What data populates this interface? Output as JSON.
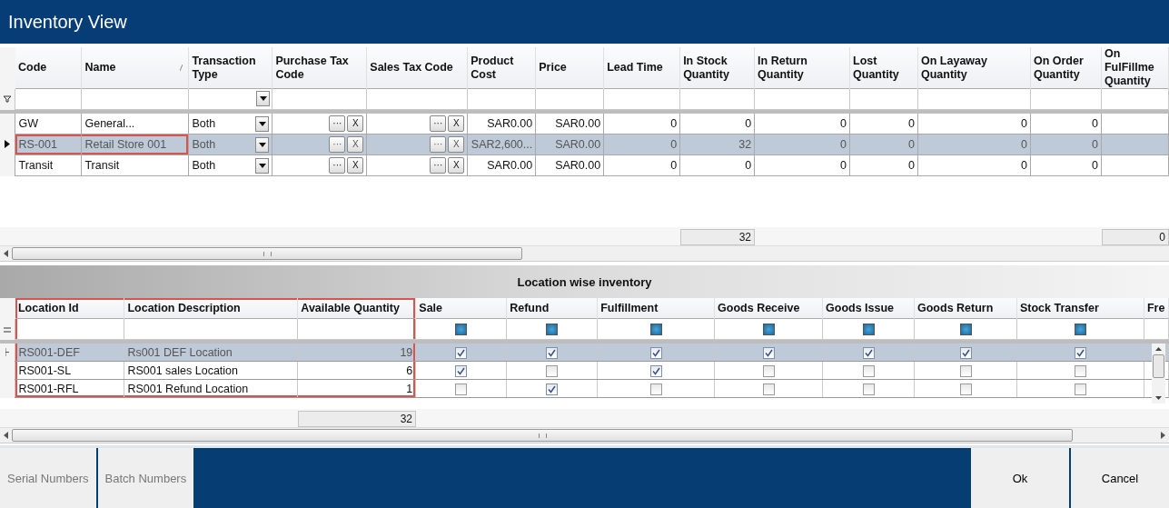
{
  "window": {
    "title": "Inventory View"
  },
  "stores_grid": {
    "columns": [
      {
        "label": "Code",
        "kind": "text",
        "sorted": false
      },
      {
        "label": "Name",
        "kind": "text",
        "sorted": true
      },
      {
        "label": "Transaction Type",
        "kind": "dropdown",
        "sorted": false
      },
      {
        "label": "Purchase Tax Code",
        "kind": "lookup",
        "sorted": false
      },
      {
        "label": "Sales Tax Code",
        "kind": "lookup",
        "sorted": false
      },
      {
        "label": "Product Cost",
        "kind": "number",
        "sorted": false
      },
      {
        "label": "Price",
        "kind": "number",
        "sorted": false
      },
      {
        "label": "Lead Time",
        "kind": "number",
        "sorted": false
      },
      {
        "label": "In Stock Quantity",
        "kind": "number",
        "sorted": false,
        "total": "32"
      },
      {
        "label": "In Return Quantity",
        "kind": "number",
        "sorted": false
      },
      {
        "label": "Lost Quantity",
        "kind": "number",
        "sorted": false
      },
      {
        "label": "On Layaway Quantity",
        "kind": "number",
        "sorted": false
      },
      {
        "label": "On Order Quantity",
        "kind": "number",
        "sorted": false
      },
      {
        "label": "On FulFillme Quantity",
        "kind": "number",
        "sorted": false,
        "total": "0"
      }
    ],
    "rows": [
      {
        "selected": false,
        "outlined": false,
        "cells": [
          "GW",
          "General...",
          "Both",
          {
            "browse": "···",
            "clear": "X"
          },
          {
            "browse": "···",
            "clear": "X"
          },
          "SAR0.00",
          "SAR0.00",
          "0",
          "0",
          "0",
          "0",
          "0",
          "0",
          ""
        ]
      },
      {
        "selected": true,
        "outlined": true,
        "cells": [
          "RS-001",
          "Retail Store 001",
          "Both",
          {
            "browse": "···",
            "clear": "X"
          },
          {
            "browse": "···",
            "clear": "X"
          },
          "SAR2,600...",
          "SAR0.00",
          "0",
          "32",
          "0",
          "0",
          "0",
          "0",
          ""
        ]
      },
      {
        "selected": false,
        "outlined": false,
        "cells": [
          "Transit",
          "Transit",
          "Both",
          {
            "browse": "···",
            "clear": "X"
          },
          {
            "browse": "···",
            "clear": "X"
          },
          "SAR0.00",
          "SAR0.00",
          "0",
          "0",
          "0",
          "0",
          "0",
          "0",
          ""
        ]
      }
    ]
  },
  "locations_grid": {
    "title": "Location wise inventory",
    "columns": [
      {
        "label": "Location Id",
        "kind": "text",
        "outlined": true
      },
      {
        "label": "Location Description",
        "kind": "text",
        "outlined": true
      },
      {
        "label": "Available Quantity",
        "kind": "number",
        "outlined": true,
        "total": "32"
      },
      {
        "label": "Sale",
        "kind": "check",
        "outlined": false,
        "filter_mixed": true
      },
      {
        "label": "Refund",
        "kind": "check",
        "outlined": false,
        "filter_mixed": true
      },
      {
        "label": "Fulfillment",
        "kind": "check",
        "outlined": false,
        "filter_mixed": true
      },
      {
        "label": "Goods Receive",
        "kind": "check",
        "outlined": false,
        "filter_mixed": true
      },
      {
        "label": "Goods Issue",
        "kind": "check",
        "outlined": false,
        "filter_mixed": true
      },
      {
        "label": "Goods Return",
        "kind": "check",
        "outlined": false,
        "filter_mixed": true
      },
      {
        "label": "Stock Transfer",
        "kind": "check",
        "outlined": false,
        "filter_mixed": true
      },
      {
        "label": "Fre",
        "kind": "blank",
        "outlined": false
      }
    ],
    "rows": [
      {
        "selected": true,
        "cells": [
          "RS001-DEF",
          "Rs001 DEF Location",
          "19"
        ],
        "checks": [
          true,
          true,
          true,
          true,
          true,
          true,
          true
        ]
      },
      {
        "selected": false,
        "cells": [
          "RS001-SL",
          "RS001 sales Location",
          "6"
        ],
        "checks": [
          true,
          false,
          true,
          false,
          false,
          false,
          false
        ]
      },
      {
        "selected": false,
        "cells": [
          "RS001-RFL",
          "RS001 Refund Location",
          "1"
        ],
        "checks": [
          false,
          true,
          false,
          false,
          false,
          false,
          false
        ]
      }
    ]
  },
  "left_buttons": [
    {
      "label": "Serial Numbers",
      "disabled": true
    },
    {
      "label": "Batch Numbers",
      "disabled": true
    }
  ],
  "right_buttons": [
    {
      "label": "Ok",
      "disabled": false
    },
    {
      "label": "Cancel",
      "disabled": false
    }
  ]
}
